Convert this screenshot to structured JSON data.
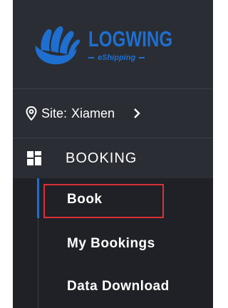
{
  "brand": {
    "name": "LOGWING",
    "tagline": "eShipping",
    "color": "#1e6fd0"
  },
  "site": {
    "label": "Site:",
    "value": "Xiamen",
    "icon": "location-pin-icon",
    "expand_icon": "chevron-right-icon"
  },
  "menu": {
    "section": {
      "label": "BOOKING",
      "icon": "grid-icon"
    },
    "items": [
      {
        "label": "Book",
        "active": true
      },
      {
        "label": "My Bookings",
        "active": false
      },
      {
        "label": "Data Download",
        "active": false
      }
    ]
  },
  "colors": {
    "sidebar_bg": "#2a2d33",
    "submenu_bg": "#1f2126",
    "active_indicator": "#1e6fd0",
    "highlight_box": "#d9303a"
  }
}
